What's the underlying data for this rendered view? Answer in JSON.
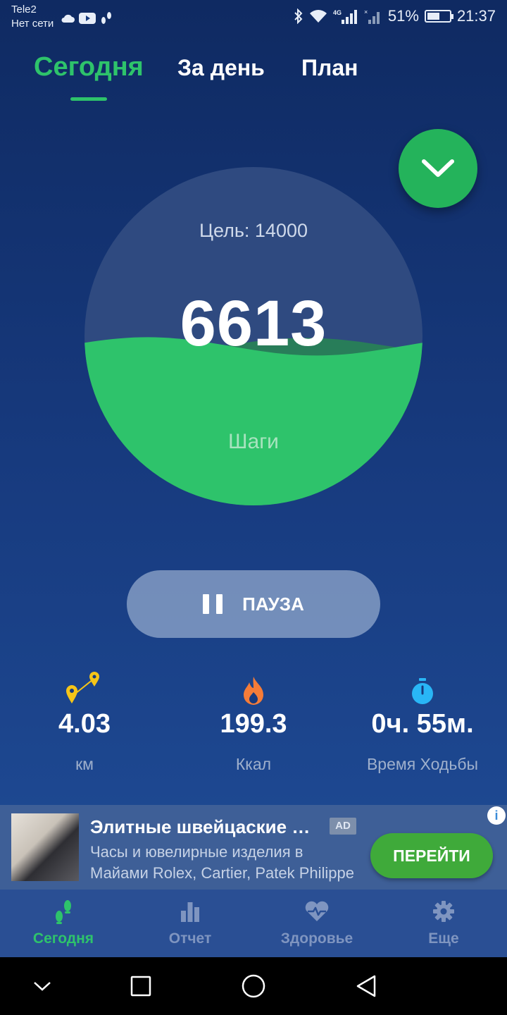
{
  "status_bar": {
    "carrier": "Tele2",
    "network_status": "Нет сети",
    "battery_percent": "51%",
    "time": "21:37"
  },
  "tabs": [
    {
      "label": "Сегодня",
      "active": true
    },
    {
      "label": "За день",
      "active": false
    },
    {
      "label": "План",
      "active": false
    }
  ],
  "gauge": {
    "goal_text": "Цель: 14000",
    "steps": "6613",
    "steps_label": "Шаги",
    "progress_fraction": 0.47,
    "fill_color": "#2ec36b"
  },
  "pause_button": {
    "label": "ПАУЗА"
  },
  "stats": [
    {
      "icon": "map-pin-route-icon",
      "value": "4.03",
      "label": "км"
    },
    {
      "icon": "flame-icon",
      "value": "199.3",
      "label": "Ккал"
    },
    {
      "icon": "stopwatch-icon",
      "value": "0ч. 55м.",
      "label": "Время Ходьбы"
    }
  ],
  "ad": {
    "title": "Элитные швейцаские часы",
    "badge": "AD",
    "desc_line1": "Часы и ювелирные изделия в",
    "desc_line2": "Майами Rolex, Cartier, Patek Philippe",
    "cta": "ПЕРЕЙТИ",
    "info": "i"
  },
  "bottom_nav": [
    {
      "label": "Сегодня",
      "icon": "footprints-icon",
      "active": true
    },
    {
      "label": "Отчет",
      "icon": "bar-chart-icon",
      "active": false
    },
    {
      "label": "Здоровье",
      "icon": "heart-pulse-icon",
      "active": false
    },
    {
      "label": "Еще",
      "icon": "gear-icon",
      "active": false
    }
  ],
  "colors": {
    "accent": "#2ec36b",
    "background_top": "#0f2a62",
    "background_bottom": "#21509c"
  }
}
